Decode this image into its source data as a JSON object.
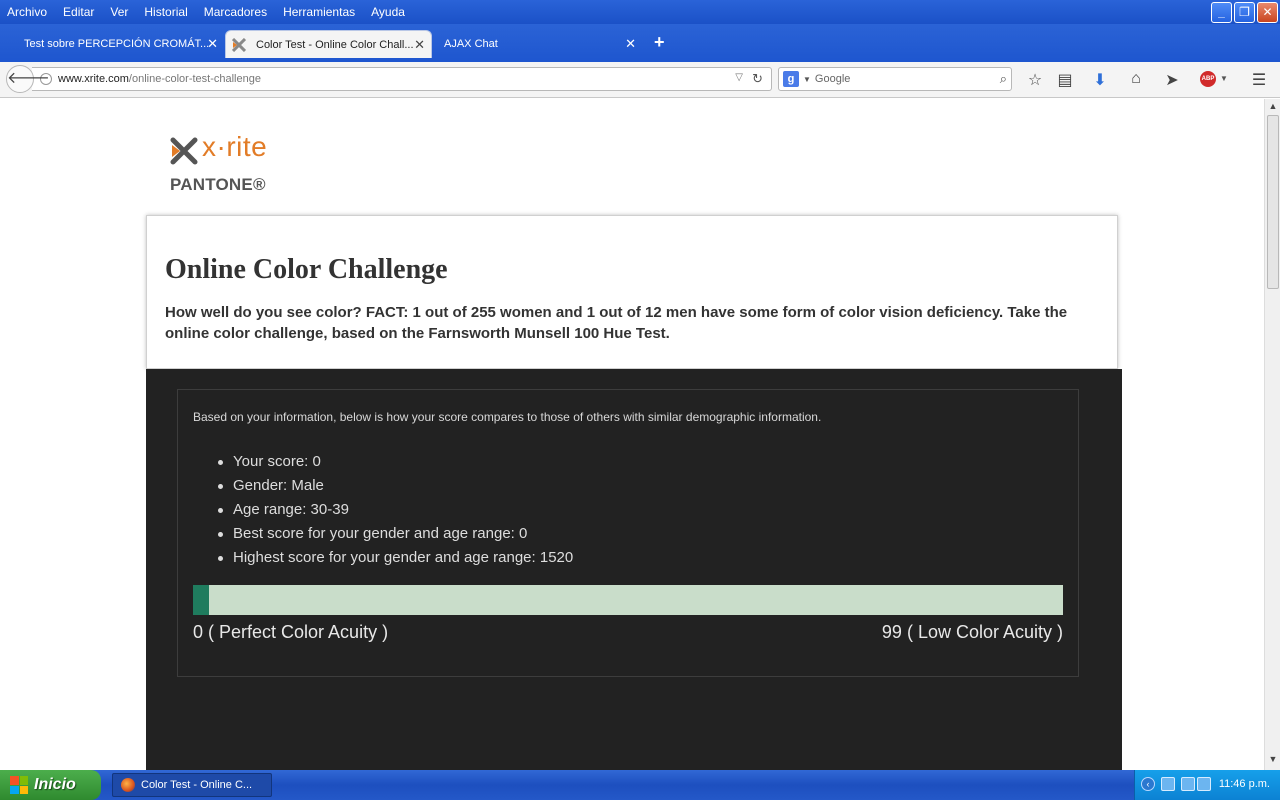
{
  "menubar": {
    "items": [
      "Archivo",
      "Editar",
      "Ver",
      "Historial",
      "Marcadores",
      "Herramientas",
      "Ayuda"
    ],
    "controls": {
      "minimize": "_",
      "restore": "❐",
      "close": "✕"
    }
  },
  "tabs": [
    {
      "title": "Test sobre PERCEPCIÓN CROMÁT...",
      "close": "✕"
    },
    {
      "title": "Color Test - Online Color Chall...",
      "close": "✕"
    },
    {
      "title": "AJAX Chat",
      "close": "✕"
    }
  ],
  "new_tab": "+",
  "navbar": {
    "url_host": "www.xrite.com",
    "url_path": "/online-color-test-challenge",
    "search_engine_letter": "g",
    "search_placeholder": "Google",
    "icons": [
      "back-icon",
      "star-icon",
      "reader-icon",
      "download-icon",
      "home-icon",
      "send-icon",
      "adblock-icon",
      "menu-icon"
    ],
    "abp_label": "ABP"
  },
  "logo": {
    "brand": "x·rite",
    "sub": "PANTONE®",
    "colors": {
      "orange": "#e27c27",
      "dark": "#444444"
    }
  },
  "intro": {
    "title": "Online Color Challenge",
    "lead": "How well do you see color? FACT: 1 out of 255 women and 1 out of 12 men have some form of color vision deficiency. Take the online color challenge, based on the Farnsworth Munsell 100 Hue Test."
  },
  "results": {
    "intro": "Based on your information, below is how your score compares to those of others with similar demographic information.",
    "items": [
      "Your score: 0",
      "Gender: Male",
      "Age range: 30-39",
      "Best score for your gender and age range: 0",
      "Highest score for your gender and age range: 1520"
    ],
    "score_fraction": 0.018,
    "scale_min": "0 ( Perfect Color Acuity )",
    "scale_max": "99 ( Low Color Acuity )",
    "colors": {
      "fill": "#1f7c5e",
      "track": "#c9ddca",
      "panel": "#222222"
    }
  },
  "taskbar": {
    "start_label": "Inicio",
    "task_title": "Color Test - Online C...",
    "clock": "11:46 p.m."
  }
}
